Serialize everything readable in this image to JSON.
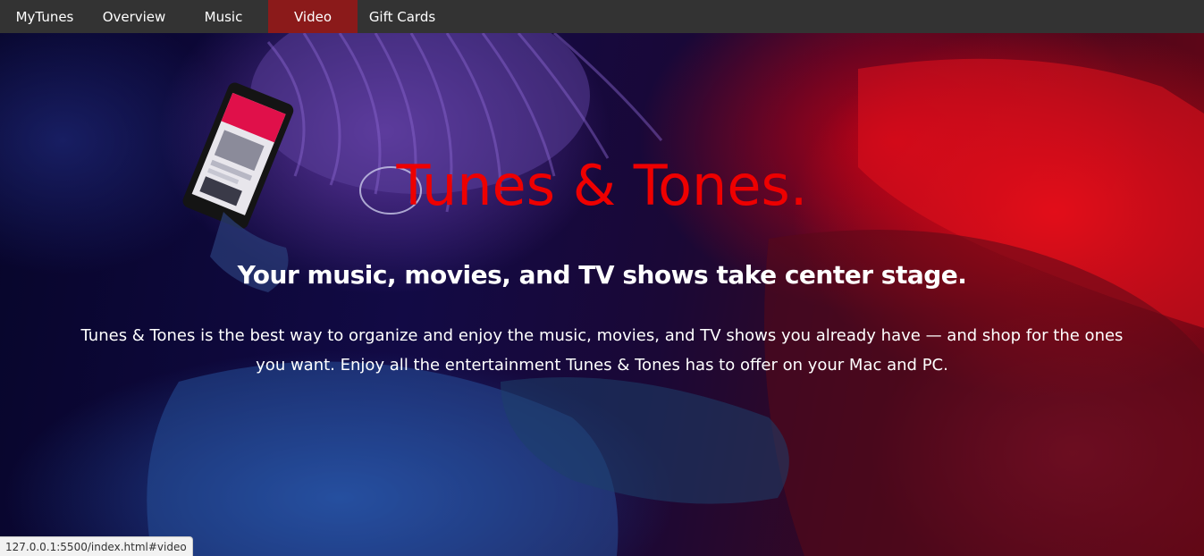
{
  "nav": {
    "items": [
      {
        "label": "MyTunes",
        "active": false
      },
      {
        "label": "Overview",
        "active": false
      },
      {
        "label": "Music",
        "active": false
      },
      {
        "label": "Video",
        "active": true
      },
      {
        "label": "Gift Cards",
        "active": false
      }
    ]
  },
  "hero": {
    "title": "Tunes & Tones.",
    "subtitle": "Your music, movies, and TV shows take center stage.",
    "body": "Tunes & Tones is the best way to organize and enjoy the music, movies, and TV shows you already have — and shop for the ones you want. Enjoy all the entertainment Tunes & Tones has to offer on your Mac and PC."
  },
  "status_bar": {
    "url": "127.0.0.1:5500/index.html#video"
  },
  "colors": {
    "navbar_bg": "#333333",
    "nav_active_bg": "#8b1a1a",
    "title_red": "#ee0000",
    "text_white": "#ffffff"
  }
}
